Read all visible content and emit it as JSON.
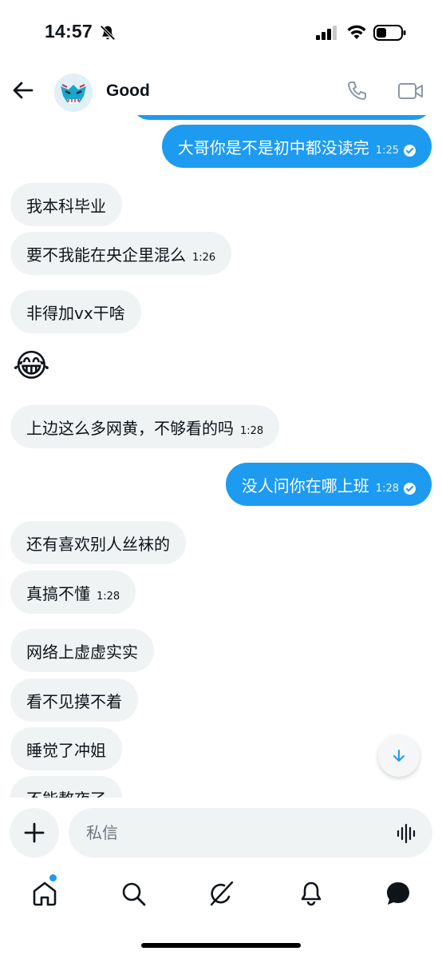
{
  "status_bar": {
    "time": "14:57"
  },
  "header": {
    "title": "Good"
  },
  "messages": [
    {
      "id": "m1",
      "direction": "out",
      "text": "大哥你是不是初中都没读完",
      "time": "1:25",
      "read": true
    },
    {
      "id": "m2",
      "direction": "in",
      "text": "我本科毕业",
      "time": ""
    },
    {
      "id": "m3",
      "direction": "in",
      "text": "要不我能在央企里混么",
      "time": "1:26"
    },
    {
      "id": "m4",
      "direction": "in",
      "text": "非得加vx干啥",
      "time": ""
    },
    {
      "id": "m5",
      "direction": "in",
      "text": "😂",
      "time": "",
      "emoji_only": true
    },
    {
      "id": "m6",
      "direction": "in",
      "text": "上边这么多网黄，不够看的吗",
      "time": "1:28"
    },
    {
      "id": "m7",
      "direction": "out",
      "text": "没人问你在哪上班",
      "time": "1:28",
      "read": true
    },
    {
      "id": "m8",
      "direction": "in",
      "text": "还有喜欢别人丝袜的",
      "time": ""
    },
    {
      "id": "m9",
      "direction": "in",
      "text": "真搞不懂",
      "time": "1:28"
    },
    {
      "id": "m10",
      "direction": "in",
      "text": "网络上虚虚实实",
      "time": ""
    },
    {
      "id": "m11",
      "direction": "in",
      "text": "看不见摸不着",
      "time": ""
    },
    {
      "id": "m12",
      "direction": "in",
      "text": "睡觉了冲姐",
      "time": ""
    },
    {
      "id": "m13",
      "direction": "in",
      "text": "不能熬夜了",
      "time": ""
    }
  ],
  "composer": {
    "placeholder": "私信"
  },
  "colors": {
    "accent": "#1d9bf0",
    "incoming_bubble": "#eff3f4",
    "text": "#0f1419"
  },
  "bottom_nav": [
    {
      "name": "home",
      "icon": "home-icon",
      "has_badge_dot": true
    },
    {
      "name": "search",
      "icon": "search-icon"
    },
    {
      "name": "grok",
      "icon": "grok-icon"
    },
    {
      "name": "notifications",
      "icon": "bell-icon"
    },
    {
      "name": "messages",
      "icon": "messages-icon"
    }
  ]
}
